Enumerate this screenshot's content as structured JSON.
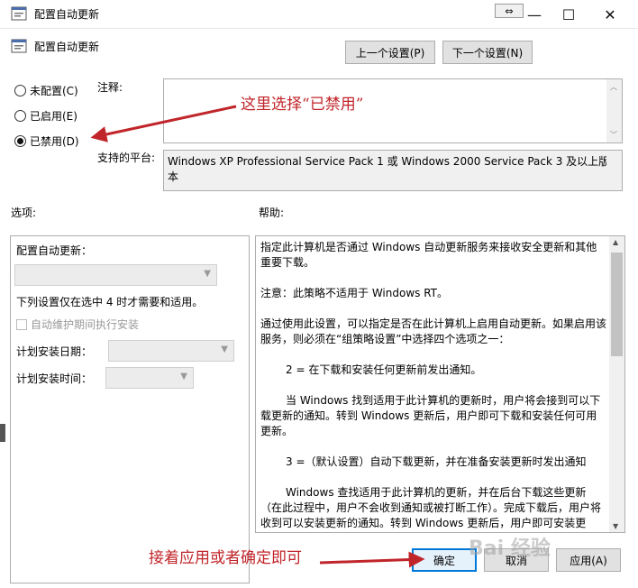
{
  "window": {
    "title": "配置自动更新",
    "minimize_glyph": "—",
    "maximize_glyph": "☐",
    "close_glyph": "✕",
    "resize_glyph": "⇔"
  },
  "header": {
    "policy_name": "配置自动更新",
    "prev_button": "上一个设置(P)",
    "next_button": "下一个设置(N)"
  },
  "state": {
    "options": [
      {
        "label": "未配置(C)",
        "checked": false
      },
      {
        "label": "已启用(E)",
        "checked": false
      },
      {
        "label": "已禁用(D)",
        "checked": true
      }
    ]
  },
  "comment": {
    "label": "注释:"
  },
  "platform": {
    "label": "支持的平台:",
    "value": "Windows XP Professional Service Pack 1 或 Windows 2000 Service Pack 3 及以上版本"
  },
  "options_panel": {
    "label": "选项:",
    "configure_label": "配置自动更新：",
    "note": "下列设置仅在选中 4 时才需要和适用。",
    "maintenance_checkbox": "自动维护期间执行安装",
    "schedule_day_label": "计划安装日期：",
    "schedule_time_label": "计划安装时间："
  },
  "help_panel": {
    "label": "帮助:",
    "paragraphs": [
      "指定此计算机是否通过 Windows 自动更新服务来接收安全更新和其他重要下载。",
      "注意：此策略不适用于 Windows RT。",
      "通过使用此设置，可以指定是否在此计算机上启用自动更新。如果启用该服务，则必须在“组策略设置”中选择四个选项之一：",
      "2 = 在下载和安装任何更新前发出通知。",
      "当 Windows 找到适用于此计算机的更新时，用户将会接到可以下载更新的通知。转到 Windows 更新后，用户即可下载和安装任何可用更新。",
      "3 =（默认设置）自动下载更新，并在准备安装更新时发出通知",
      "Windows 查找适用于此计算机的更新，并在后台下载这些更新（在此过程中，用户不会收到通知或被打断工作）。完成下载后，用户将收到可以安装更新的通知。转到 Windows 更新后，用户即可安装更新。"
    ]
  },
  "footer": {
    "ok": "确定",
    "cancel": "取消",
    "apply": "应用(A)"
  },
  "annotations": {
    "select_disabled": "这里选择“已禁用”",
    "apply_or_ok": "接着应用或者确定即可"
  },
  "watermark": "Bai 经验",
  "colors": {
    "annotation": "#c0252a",
    "ok_border": "#0078d7"
  }
}
